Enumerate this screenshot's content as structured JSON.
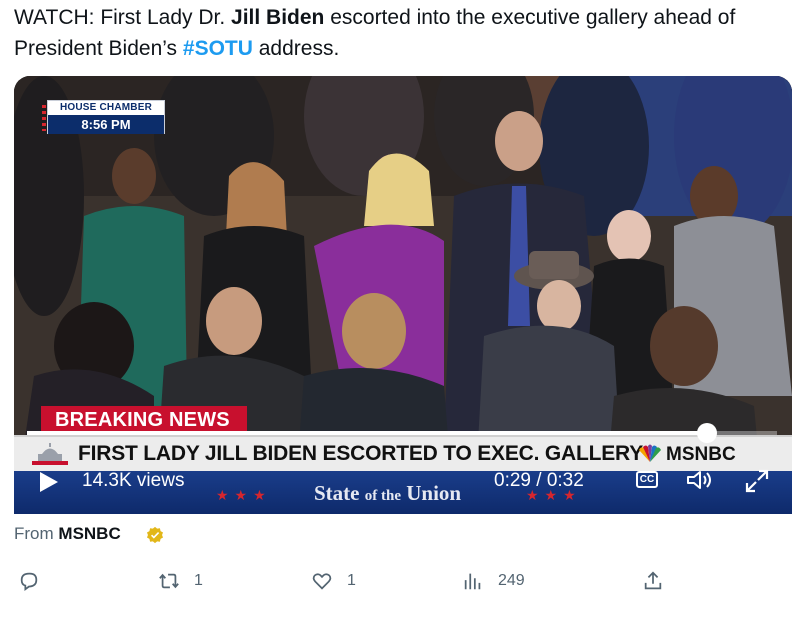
{
  "tweet": {
    "text_prefix": "WATCH: First Lady Dr. ",
    "text_bold": "Jill Biden",
    "text_mid": "  escorted into the executive gallery ahead of President Biden’s ",
    "hashtag": "#SOTU",
    "text_suffix": " address."
  },
  "video": {
    "chamber_label": "HOUSE CHAMBER",
    "chamber_time": "8:56 PM",
    "breaking_label": "BREAKING NEWS",
    "headline": "FIRST LADY JILL BIDEN ESCORTED TO EXEC. GALLERY",
    "network": "MSNBC",
    "sotu_main": "State",
    "sotu_of": "of the",
    "sotu_end": "Union",
    "views": "14.3K views",
    "time": "0:29 / 0:32",
    "cc_label": "CC",
    "progress_fraction": 0.906
  },
  "source": {
    "from_label": "From",
    "account": "MSNBC"
  },
  "actions": {
    "reply_count": "",
    "retweet_count": "1",
    "like_count": "1",
    "views_count": "249"
  },
  "colors": {
    "hashtag": "#1d9bf0",
    "breaking": "#c8102e",
    "controls_bg": "#0e2a6b",
    "verified": "#e2b719"
  },
  "icons": [
    "reply-icon",
    "retweet-icon",
    "like-icon",
    "views-chart-icon",
    "share-icon",
    "play-icon",
    "cc-icon",
    "volume-icon",
    "fullscreen-icon",
    "verified-badge-icon",
    "msnbc-peacock-icon",
    "capitol-icon"
  ]
}
